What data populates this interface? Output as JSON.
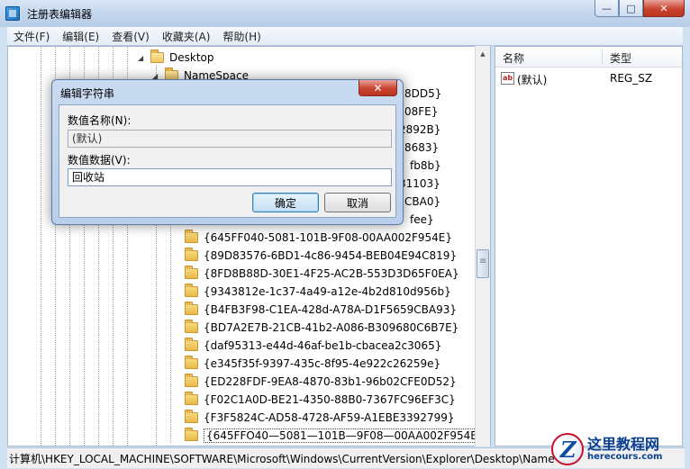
{
  "window": {
    "title": "注册表编辑器",
    "controls": {
      "minimize": "—",
      "maximize": "□",
      "close": "✕"
    }
  },
  "menu": [
    "文件(F)",
    "编辑(E)",
    "查看(V)",
    "收藏夹(A)",
    "帮助(H)"
  ],
  "tree": {
    "parents": [
      {
        "label": "Desktop",
        "expanded": true
      },
      {
        "label": "NameSpace",
        "expanded": true
      }
    ],
    "partial_behind_dialog": [
      "8DD5}",
      "08FE}",
      "2892B}",
      "8683}",
      "fb8b}",
      "31103}",
      "CBA0}",
      "fee}"
    ],
    "children": [
      "{645FF040-5081-101B-9F08-00AA002F954E}",
      "{89D83576-6BD1-4c86-9454-BEB04E94C819}",
      "{8FD8B88D-30E1-4F25-AC2B-553D3D65F0EA}",
      "{9343812e-1c37-4a49-a12e-4b2d810d956b}",
      "{B4FB3F98-C1EA-428d-A78A-D1F5659CBA93}",
      "{BD7A2E7B-21CB-41b2-A086-B309680C6B7E}",
      "{daf95313-e44d-46af-be1b-cbacea2c3065}",
      "{e345f35f-9397-435c-8f95-4e922c26259e}",
      "{ED228FDF-9EA8-4870-83b1-96b02CFE0D52}",
      "{F02C1A0D-BE21-4350-88B0-7367FC96EF3C}",
      "{F3F5824C-AD58-4728-AF59-A1EBE3392799}",
      "{645FFO40—5081—101B—9F08—00AA002F954E}"
    ]
  },
  "list": {
    "col_name": "名称",
    "col_type": "类型",
    "rows": [
      {
        "name": "(默认)",
        "type": "REG_SZ"
      }
    ]
  },
  "dialog": {
    "title": "编辑字符串",
    "close": "✕",
    "name_label": "数值名称(N):",
    "name_value": "(默认)",
    "data_label": "数值数据(V):",
    "data_value": "回收站",
    "ok": "确定",
    "cancel": "取消"
  },
  "statusbar": "计算机\\HKEY_LOCAL_MACHINE\\SOFTWARE\\Microsoft\\Windows\\CurrentVersion\\Explorer\\Desktop\\Name",
  "watermark": {
    "name": "这里教程网",
    "url": "herecours.com"
  }
}
